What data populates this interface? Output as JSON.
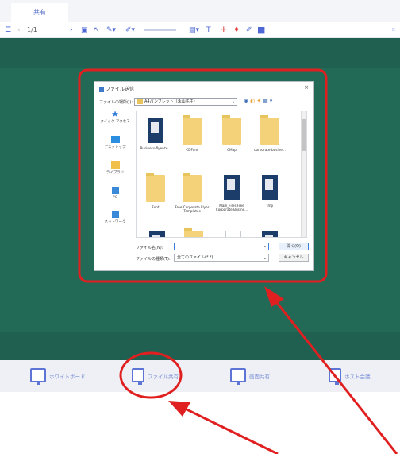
{
  "tab": {
    "label": "共有"
  },
  "toolbar": {
    "page_indicator": "1/1",
    "icons": [
      "list-icon",
      "prev-page-icon",
      "next-page-icon",
      "save-icon",
      "pointer-icon",
      "pen-icon",
      "highlighter-icon",
      "text-icon",
      "laser-icon",
      "eraser-icon",
      "clear-icon",
      "color-icon",
      "layout-icon"
    ]
  },
  "dialog": {
    "title": "ファイル送信",
    "close": "×",
    "lookin_label": "ファイルの場所(I):",
    "lookin_value": "A4パンフレット（永山先生）",
    "places": [
      {
        "label": "クイック アクセス",
        "icon": "star-icon"
      },
      {
        "label": "デスクトップ",
        "icon": "desktop-icon"
      },
      {
        "label": "ライブラリ",
        "icon": "library-icon"
      },
      {
        "label": "PC",
        "icon": "pc-icon"
      },
      {
        "label": "ネットワーク",
        "icon": "network-icon"
      }
    ],
    "files": [
      {
        "name": "Business-flyer-te...",
        "kind": "doc-blue"
      },
      {
        "name": "CDFont",
        "kind": "folder"
      },
      {
        "name": "CMap",
        "kind": "folder"
      },
      {
        "name": "corporate-busine...",
        "kind": "folder"
      },
      {
        "name": "Font",
        "kind": "folder"
      },
      {
        "name": "Free Corporate Flyer Templates",
        "kind": "folder"
      },
      {
        "name": "Main_Files Free Corporate Busine...",
        "kind": "doc-blue"
      },
      {
        "name": "tmp",
        "kind": "doc-blue"
      }
    ],
    "filename_label": "ファイル名(N):",
    "filename_value": "",
    "filetype_label": "ファイルの種類(T):",
    "filetype_value": "全てのファイル(*.*)",
    "open_button": "開く(O)",
    "cancel_button": "キャンセル"
  },
  "bottom": {
    "items": [
      {
        "label": "ホワイトボード",
        "icon": "whiteboard-icon"
      },
      {
        "label": "ファイル共有",
        "icon": "file-share-icon"
      },
      {
        "label": "画面共有",
        "icon": "screen-share-icon"
      },
      {
        "label": "ホスト会議",
        "icon": "host-meeting-icon"
      }
    ]
  },
  "colors": {
    "accent": "#4e67d4",
    "stage": "#206050",
    "annotation": "#e02020"
  }
}
